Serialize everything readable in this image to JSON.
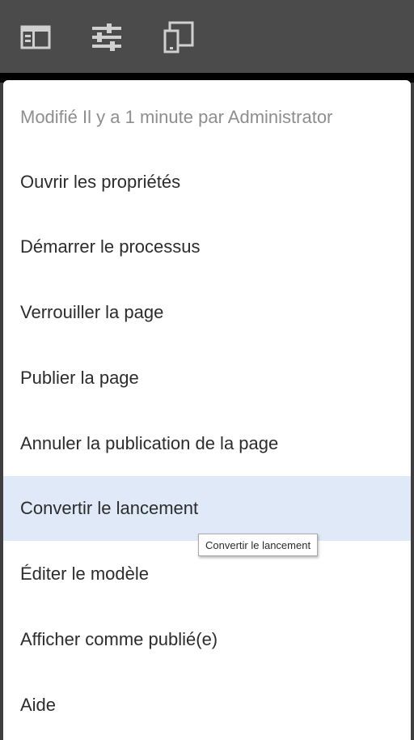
{
  "toolbar": {
    "icons": [
      "sidebar-panel-icon",
      "properties-sliders-icon",
      "device-emulator-icon"
    ],
    "icon_color": "#d0d0d0"
  },
  "menu": {
    "header": "Modifié Il y a 1 minute par Administrator",
    "items": [
      {
        "label": "Ouvrir les propriétés"
      },
      {
        "label": "Démarrer le processus"
      },
      {
        "label": "Verrouiller la page"
      },
      {
        "label": "Publier la page"
      },
      {
        "label": "Annuler la publication de la page"
      },
      {
        "label": "Convertir le lancement",
        "selected": true
      },
      {
        "label": "Éditer le modèle"
      },
      {
        "label": "Afficher comme publié(e)"
      },
      {
        "label": "Aide"
      }
    ],
    "selected_color": "#e0e9f7"
  },
  "tooltip": {
    "text": "Convertir le lancement"
  }
}
